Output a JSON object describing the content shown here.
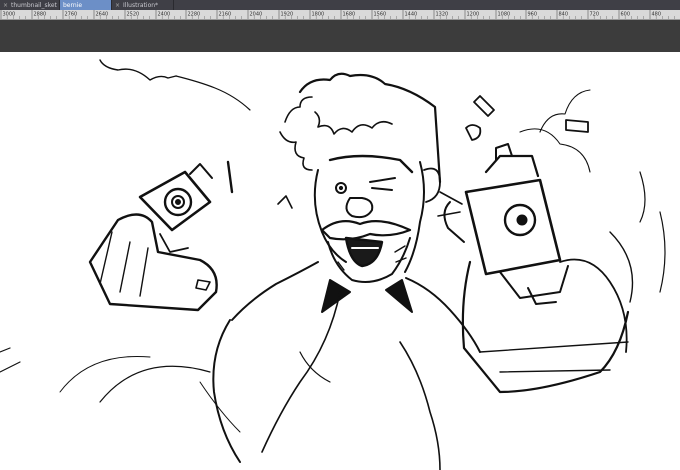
{
  "tabs": [
    {
      "label": "thumbnail_sket",
      "close": "×",
      "active": false
    },
    {
      "label": "bernie",
      "close": "",
      "active": true
    },
    {
      "label": "Illustration*",
      "close": "×",
      "active": false
    }
  ],
  "ruler": {
    "ticks": [
      "3000",
      "2880",
      "2760",
      "2640",
      "2520",
      "2400",
      "2280",
      "2160",
      "2040",
      "1920",
      "1800",
      "1680",
      "1560",
      "1440",
      "1320",
      "1200",
      "1080",
      "960",
      "840",
      "720",
      "600",
      "480"
    ]
  },
  "colors": {
    "tab_active": "#6c8fc7",
    "tabbar": "#3f3f46",
    "ruler": "#d9d9d9",
    "toolbar": "#3c3c3c",
    "canvas": "#ffffff",
    "ink": "#111111"
  }
}
